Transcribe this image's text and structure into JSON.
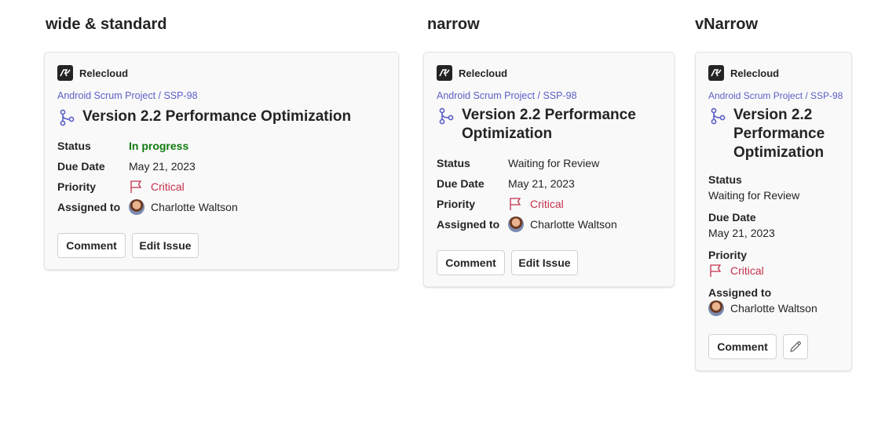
{
  "headings": {
    "wide": "wide & standard",
    "narrow": "narrow",
    "vnarrow": "vNarrow"
  },
  "brand": {
    "name": "Relecloud",
    "logo_icon": "relecloud-logo-icon"
  },
  "colors": {
    "accent": "#5b5fc7",
    "in_progress": "#107c10",
    "critical": "#c4314b",
    "text": "#242424",
    "card_bg": "#f9f9f9"
  },
  "cards": {
    "wide": {
      "breadcrumb": "Android Scrum Project / SSP-98",
      "title": "Version 2.2 Performance Optimization",
      "facts": {
        "status_label": "Status",
        "status_value": "In progress",
        "due_label": "Due Date",
        "due_value": "May 21, 2023",
        "priority_label": "Priority",
        "priority_value": "Critical",
        "assigned_label": "Assigned to",
        "assigned_value": "Charlotte Waltson"
      },
      "actions": {
        "comment": "Comment",
        "edit": "Edit Issue"
      }
    },
    "narrow": {
      "breadcrumb": "Android Scrum Project / SSP-98",
      "title_line1": "Version 2.2 Performance",
      "title_line2": "Optimization",
      "facts": {
        "status_label": "Status",
        "status_value": "Waiting for Review",
        "due_label": "Due Date",
        "due_value": "May 21, 2023",
        "priority_label": "Priority",
        "priority_value": "Critical",
        "assigned_label": "Assigned to",
        "assigned_value": "Charlotte Waltson"
      },
      "actions": {
        "comment": "Comment",
        "edit": "Edit Issue"
      }
    },
    "vnarrow": {
      "breadcrumb": "Android Scrum Project / SSP-98",
      "title_line1": "Version 2.2",
      "title_line2": "Performance",
      "title_line3": "Optimization",
      "facts": {
        "status_label": "Status",
        "status_value": "Waiting for Review",
        "due_label": "Due Date",
        "due_value": "May 21, 2023",
        "priority_label": "Priority",
        "priority_value": "Critical",
        "assigned_label": "Assigned to",
        "assigned_value": "Charlotte Waltson"
      },
      "actions": {
        "comment": "Comment",
        "edit_icon": "pencil-icon"
      }
    }
  }
}
